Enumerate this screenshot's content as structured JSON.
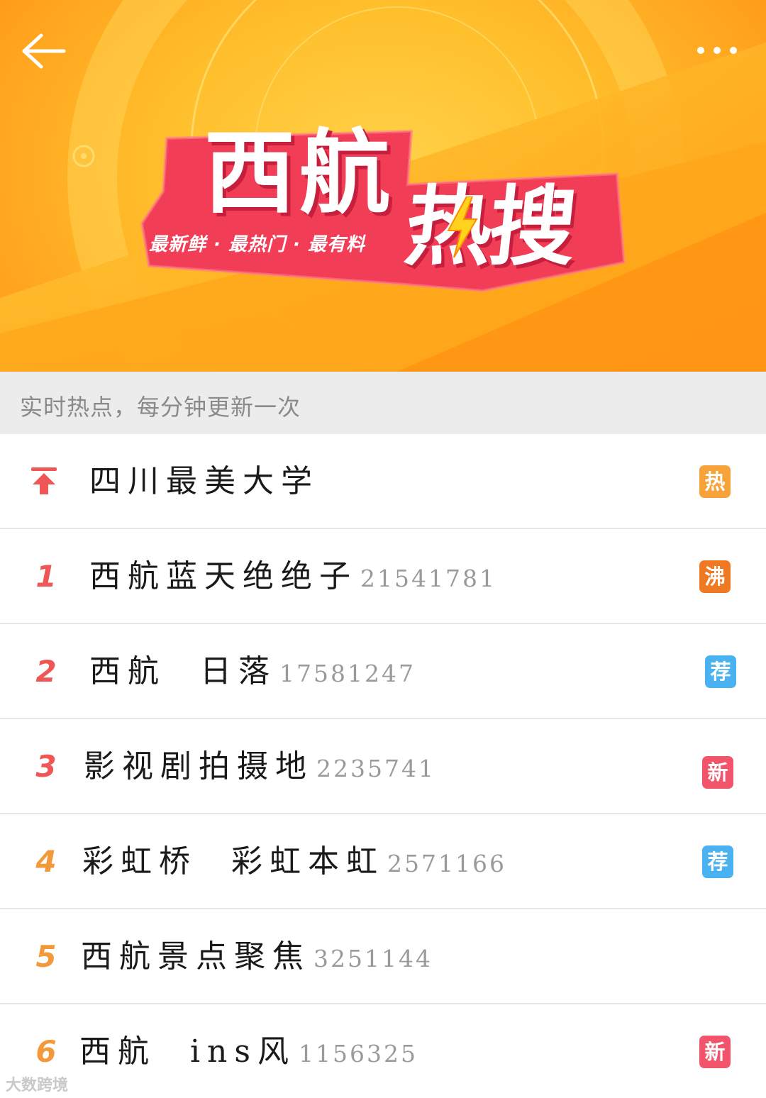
{
  "banner": {
    "title": "西航",
    "hot_label": "热搜",
    "slogan": "最新鲜 · 最热门 · 最有料"
  },
  "icons": {
    "back": "arrow-left-icon",
    "more": "more-dots-icon",
    "pin": "pin-top-icon",
    "bolt": "lightning-icon"
  },
  "subheader": {
    "text": "实时热点，每分钟更新一次"
  },
  "colors": {
    "rank_red": "#ef5757",
    "rank_orange": "#f29a3b",
    "tag_hot": "#f8a23a",
    "tag_boil": "#f07a24",
    "tag_recommend": "#4ab2f0",
    "tag_new": "#f2556b"
  },
  "list": {
    "pinned": {
      "title": "四川最美大学",
      "tag": "热"
    },
    "items": [
      {
        "rank": "1",
        "title": "西航蓝天绝绝子",
        "count": "21541781",
        "tag": "沸"
      },
      {
        "rank": "2",
        "title": "西航  日落",
        "count": "17581247",
        "tag": "荐"
      },
      {
        "rank": "3",
        "title": "影视剧拍摄地",
        "count": "2235741",
        "tag": "新"
      },
      {
        "rank": "4",
        "title": "彩虹桥  彩虹本虹",
        "count": "2571166",
        "tag": "荐"
      },
      {
        "rank": "5",
        "title": "西航景点聚焦",
        "count": "3251144",
        "tag": ""
      },
      {
        "rank": "6",
        "title": "西航  ins风",
        "count": "1156325",
        "tag": "新"
      }
    ]
  },
  "watermark": "大数跨境"
}
